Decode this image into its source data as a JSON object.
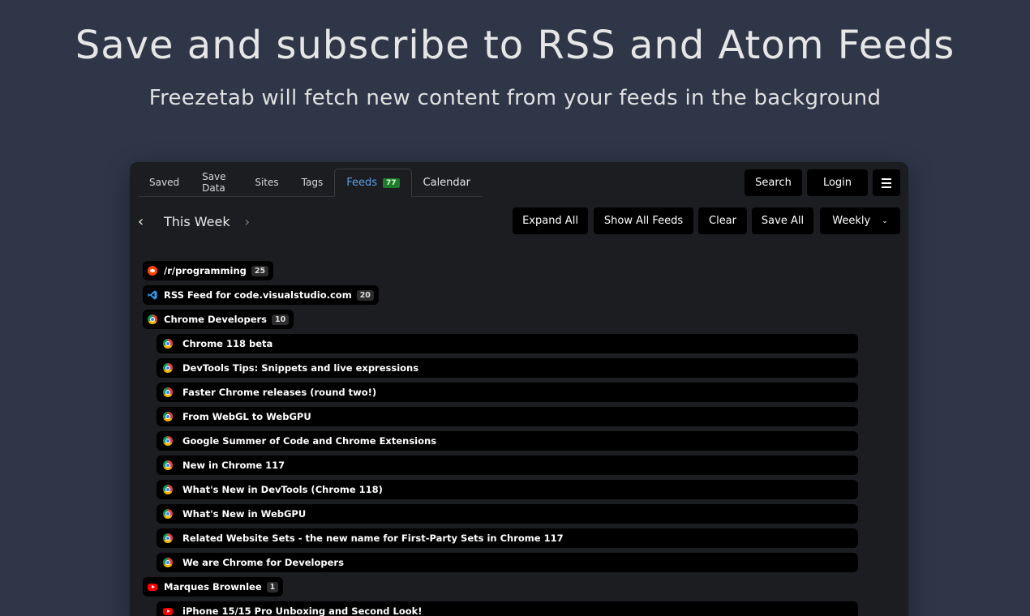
{
  "hero": {
    "title": "Save and subscribe to RSS and Atom Feeds",
    "subtitle": "Freezetab will fetch new content from your feeds in the background"
  },
  "tabs": [
    {
      "label": "Saved"
    },
    {
      "label": "Save Data"
    },
    {
      "label": "Sites"
    },
    {
      "label": "Tags"
    },
    {
      "label": "Feeds",
      "badge": "77",
      "active": true
    },
    {
      "label": "Calendar"
    }
  ],
  "top_buttons": {
    "search": "Search",
    "login": "Login",
    "menu_icon": "hamburger-icon"
  },
  "week": {
    "label": "This Week",
    "prev_icon": "chevron-left-icon",
    "next_icon": "chevron-right-icon"
  },
  "actions": {
    "expand_all": "Expand All",
    "show_all_feeds": "Show All Feeds",
    "clear": "Clear",
    "save_all": "Save All",
    "period": "Weekly"
  },
  "feeds": [
    {
      "name": "/r/programming",
      "count": "25",
      "icon": "reddit-icon",
      "items": []
    },
    {
      "name": "RSS Feed for code.visualstudio.com",
      "count": "20",
      "icon": "vscode-icon",
      "items": []
    },
    {
      "name": "Chrome Developers",
      "count": "10",
      "icon": "chrome-icon",
      "items": [
        "Chrome 118 beta",
        "DevTools Tips: Snippets and live expressions",
        "Faster Chrome releases (round two!)",
        "From WebGL to WebGPU",
        "Google Summer of Code and Chrome Extensions",
        "New in Chrome 117",
        "What's New in DevTools (Chrome 118)",
        "What's New in WebGPU",
        "Related Website Sets - the new name for First-Party Sets in Chrome 117",
        "We are Chrome for Developers"
      ]
    },
    {
      "name": "Marques Brownlee",
      "count": "1",
      "icon": "youtube-icon",
      "items": [
        "iPhone 15/15 Pro Unboxing and Second Look!"
      ]
    }
  ],
  "colors": {
    "page_bg": "#2e3648",
    "panel_bg": "#1c1d21",
    "accent": "#5aa0e6",
    "badge_green": "#1f7a2b"
  }
}
